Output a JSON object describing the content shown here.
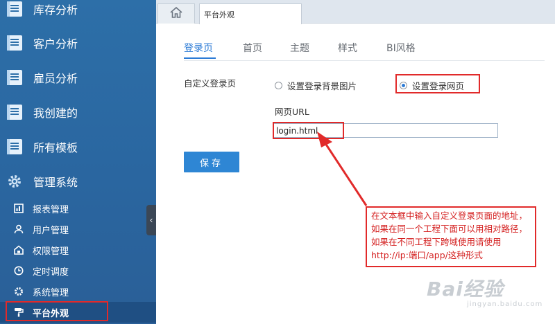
{
  "sidebar": {
    "items": [
      {
        "label": "库存分析"
      },
      {
        "label": "客户分析"
      },
      {
        "label": "雇员分析"
      },
      {
        "label": "我创建的"
      },
      {
        "label": "所有模板"
      },
      {
        "label": "管理系统"
      }
    ],
    "subitems": [
      {
        "label": "报表管理"
      },
      {
        "label": "用户管理"
      },
      {
        "label": "权限管理"
      },
      {
        "label": "定时调度"
      },
      {
        "label": "系统管理"
      },
      {
        "label": "平台外观"
      }
    ],
    "collapse_glyph": "‹"
  },
  "topbar": {
    "page_tab": "平台外观"
  },
  "tabs": [
    {
      "label": "登录页"
    },
    {
      "label": "首页"
    },
    {
      "label": "主题"
    },
    {
      "label": "样式"
    },
    {
      "label": "BI风格"
    }
  ],
  "form": {
    "custom_login_label": "自定义登录页",
    "option_bg_image": "设置登录背景图片",
    "option_web_page": "设置登录网页",
    "url_label": "网页URL",
    "url_value": "login.html",
    "save_label": "保存"
  },
  "annotation": {
    "text": "在文本框中输入自定义登录页面的地址，如果在同一个工程下面可以用相对路径，如果在不同工程下跨域使用请使用http://ip:端口/app/这种形式"
  },
  "watermark": {
    "main": "Bai经验",
    "sub": "jingyan.baidu.com"
  },
  "colors": {
    "sidebar": "#2d6fa8",
    "accent": "#2c7bd6",
    "highlight": "#e12a2a"
  }
}
